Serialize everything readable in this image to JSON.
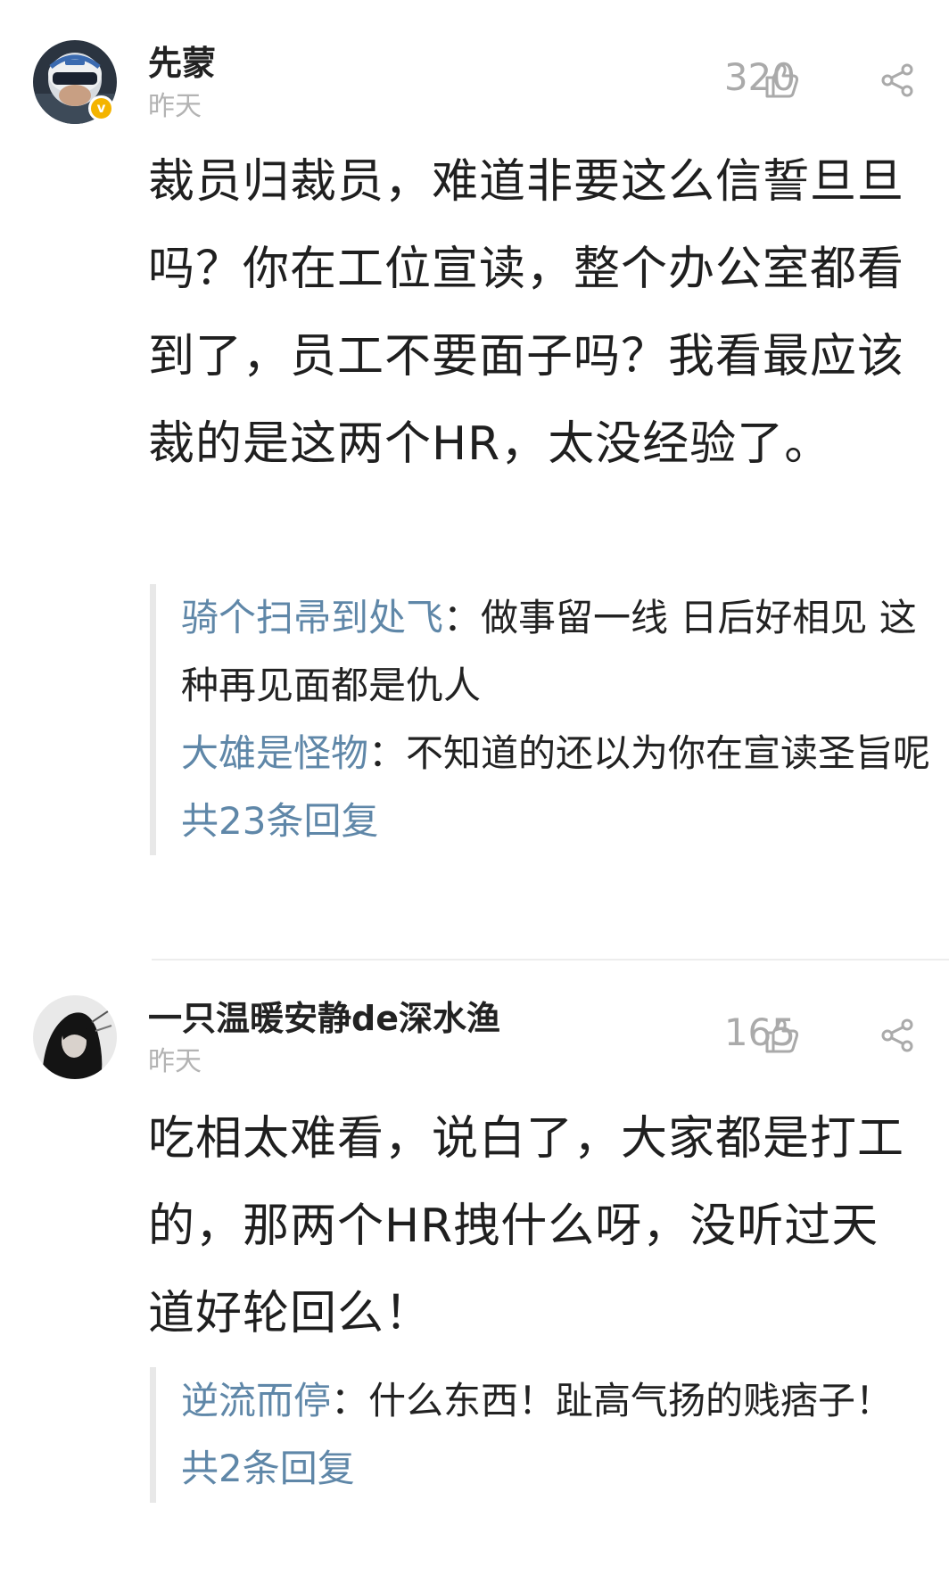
{
  "comments": [
    {
      "username": "先蒙",
      "verified_mark": "v",
      "time": "昨天",
      "likes": "320",
      "avatar_icon": "helmet-avatar",
      "text": "裁员归裁员，难道非要这么信誓旦旦吗？你在工位宣读，整个办公室都看到了，员工不要面子吗？我看最应该裁的是这两个HR，太没经验了。",
      "replies": [
        {
          "name": "骑个扫帚到处飞",
          "sep": "：",
          "text": "做事留一线 日后好相见 这种再见面都是仇人"
        },
        {
          "name": "大雄是怪物",
          "sep": "：",
          "text": "不知道的还以为你在宣读圣旨呢"
        }
      ],
      "reply_total": "共23条回复"
    },
    {
      "username": "一只温暖安静de深水渔",
      "time": "昨天",
      "likes": "165",
      "avatar_icon": "girl-avatar",
      "text": "吃相太难看，说白了，大家都是打工的，那两个HR拽什么呀，没听过天道好轮回么！",
      "replies": [
        {
          "name": "逆流而停",
          "sep": "：",
          "text": "什么东西！趾高气扬的贱痞子！"
        }
      ],
      "reply_total": "共2条回复"
    }
  ],
  "colors": {
    "reply_name": "#5f87a8",
    "meta_gray": "#b3b3b3",
    "verified": "#f4b400"
  }
}
